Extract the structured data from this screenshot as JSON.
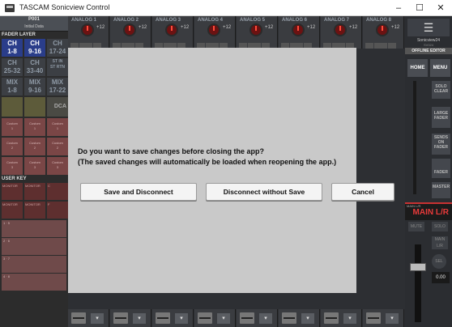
{
  "window": {
    "title": "TASCAM Sonicview Control",
    "minimize": "–",
    "maximize": "☐",
    "close": "✕"
  },
  "left_panel": {
    "project": "P001",
    "scene": "Initial Data",
    "fader_layer_label": "FADER LAYER",
    "fader_layers": [
      {
        "top": "CH",
        "bottom": "1-8",
        "selected": true
      },
      {
        "top": "CH",
        "bottom": "9-16",
        "selected": true
      },
      {
        "top": "CH",
        "bottom": "17-24",
        "selected": false
      },
      {
        "top": "CH",
        "bottom": "25-32",
        "selected": false
      },
      {
        "top": "CH",
        "bottom": "33-40",
        "selected": false
      },
      {
        "top": "ST IN",
        "bottom": "ST RTN",
        "selected": false
      },
      {
        "top": "MIX",
        "bottom": "1-8",
        "selected": false
      },
      {
        "top": "MIX",
        "bottom": "9-16",
        "selected": false
      },
      {
        "top": "MIX",
        "bottom": "17-22",
        "selected": false
      }
    ],
    "dca_label": "DCA",
    "custom_label": "Custom",
    "customs": [
      "1",
      "1",
      "1",
      "2",
      "2",
      "2",
      "3",
      "3",
      "3"
    ],
    "user_key_label": "USER KEY",
    "user_keys": [
      "MONITOR",
      "MONITOR",
      "C",
      "MONITOR",
      "MONITOR",
      "F"
    ]
  },
  "channels": [
    {
      "name": "ANALOG 1",
      "gain": "+12"
    },
    {
      "name": "ANALOG 2",
      "gain": "+12"
    },
    {
      "name": "ANALOG 3",
      "gain": "+12"
    },
    {
      "name": "ANALOG 4",
      "gain": "+12"
    },
    {
      "name": "ANALOG 5",
      "gain": "+12"
    },
    {
      "name": "ANALOG 6",
      "gain": "+12"
    },
    {
      "name": "ANALOG 7",
      "gain": "+12"
    },
    {
      "name": "ANALOG 8",
      "gain": "+12"
    }
  ],
  "right_panel": {
    "menu_icon": "☰",
    "device_name": "Sonicview24",
    "device_sub": "SV024",
    "offline_label": "OFFLINE EDITOR",
    "home_label": "HOME",
    "menu_label": "MENU",
    "solo_clear": "SOLO CLEAR",
    "large_fader": "LARGE FADER",
    "sends_on_fader": "SENDS ON FADER",
    "fader_label": "FADER",
    "master_label": "MASTER",
    "main_lr_small": "MAIN L/R",
    "main_lr": "MAIN L/R",
    "mute": "MUTE",
    "solo": "SOLO",
    "main_lr_btn": "MAIN L/R",
    "sel": "SEL",
    "value": "0.00"
  },
  "dialog": {
    "line1": "Do you want to save changes before closing the app?",
    "line2": " (The saved changes will automatically be loaded when reopening the app.)",
    "btn_save": "Save and Disconnect",
    "btn_nosave": "Disconnect without Save",
    "btn_cancel": "Cancel"
  }
}
